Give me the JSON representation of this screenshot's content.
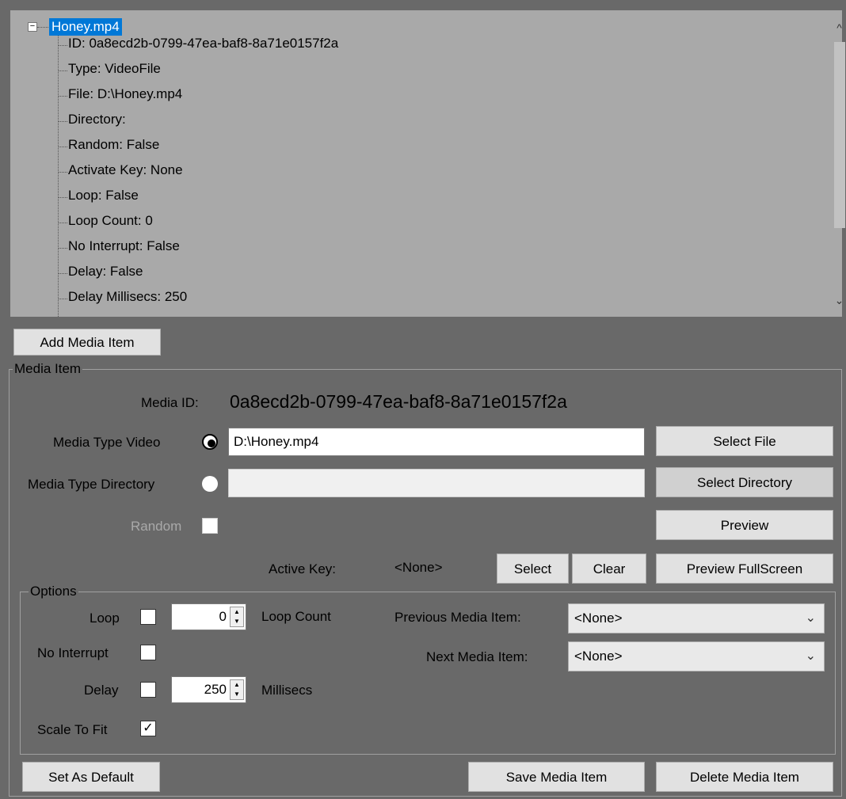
{
  "tree": {
    "root_label": "Honey.mp4",
    "expander": "−",
    "children": [
      "ID: 0a8ecd2b-0799-47ea-baf8-8a71e0157f2a",
      "Type: VideoFile",
      "File: D:\\Honey.mp4",
      "Directory:",
      "Random: False",
      "Activate Key: None",
      "Loop: False",
      "Loop Count: 0",
      "No Interrupt: False",
      "Delay: False",
      "Delay Millisecs: 250"
    ]
  },
  "scrollbar": {
    "up_icon": "^",
    "down_icon": "⌄"
  },
  "add_media_item_label": "Add Media Item",
  "media_item": {
    "legend": "Media Item",
    "media_id_label": "Media ID:",
    "media_id_value": "0a8ecd2b-0799-47ea-baf8-8a71e0157f2a",
    "video_label": "Media Type Video",
    "video_path": "D:\\Honey.mp4",
    "directory_label": "Media Type Directory",
    "directory_path": "",
    "select_file_label": "Select File",
    "select_directory_label": "Select Directory",
    "random_label": "Random",
    "preview_label": "Preview",
    "active_key_label": "Active Key:",
    "active_key_value": "<None>",
    "select_label": "Select",
    "clear_label": "Clear",
    "preview_fullscreen_label": "Preview FullScreen"
  },
  "options": {
    "legend": "Options",
    "loop_label": "Loop",
    "loop_count_value": "0",
    "loop_count_label": "Loop Count",
    "no_interrupt_label": "No Interrupt",
    "delay_label": "Delay",
    "delay_value": "250",
    "millisecs_label": "Millisecs",
    "scale_to_fit_label": "Scale To Fit",
    "scale_to_fit_check": "✓",
    "previous_media_label": "Previous Media Item:",
    "previous_media_value": "<None>",
    "next_media_label": "Next Media Item:",
    "next_media_value": "<None>"
  },
  "footer": {
    "set_default_label": "Set As Default",
    "save_label": "Save Media Item",
    "delete_label": "Delete Media Item"
  }
}
